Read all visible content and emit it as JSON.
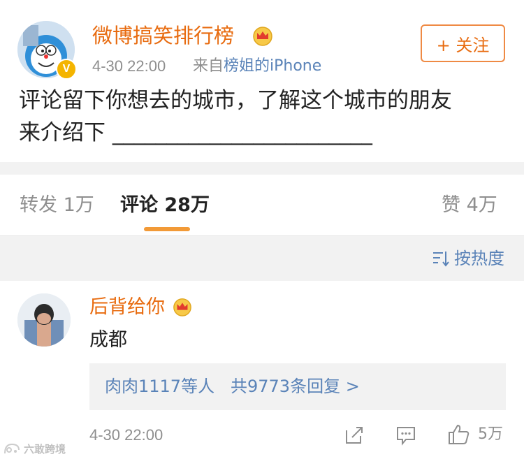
{
  "post": {
    "author": "微博搞笑排行榜",
    "time": "4-30 22:00",
    "source_prefix": "来自",
    "source_name": "榜姐的iPhone",
    "follow_label": "+ 关注",
    "text_line1": "评论留下你想去的城市，了解这个城市的朋友",
    "text_line2": "来介绍下 ________________________"
  },
  "tabs": {
    "repost": "转发 1万",
    "comments": "评论 28万",
    "likes": "赞 4万"
  },
  "sort_label": "按热度",
  "comment": {
    "author": "后背给你",
    "text": "成都",
    "reply_users": "肉肉1117等人",
    "reply_count": "共9773条回复 >",
    "time": "4-30 22:00",
    "like_count": "5万"
  },
  "watermark": "六敢跨境",
  "colors": {
    "accent_orange": "#e86b0f",
    "link_blue": "#5a83b8",
    "tab_underline": "#f29a37"
  }
}
